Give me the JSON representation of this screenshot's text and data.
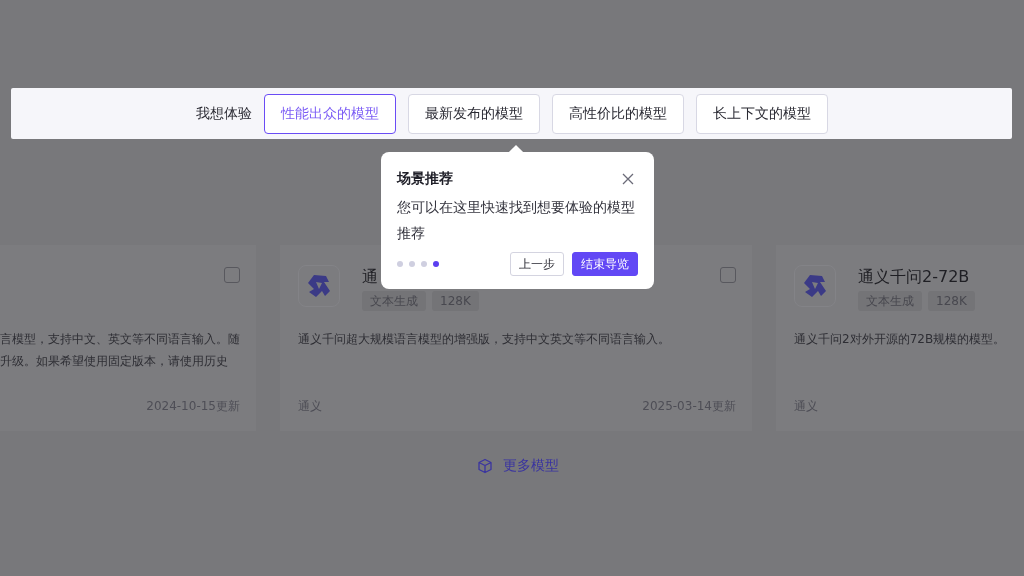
{
  "scenario_bar": {
    "label": "我想体验",
    "options": [
      {
        "label": "性能出众的模型",
        "selected": true
      },
      {
        "label": "最新发布的模型",
        "selected": false
      },
      {
        "label": "高性价比的模型",
        "selected": false
      },
      {
        "label": "长上下文的模型",
        "selected": false
      }
    ]
  },
  "model_cards": [
    {
      "checked": false,
      "description_lines": [
        "言模型，支持中文、英文等不同语言输入。随",
        "升级。如果希望使用固定版本，请使用历史"
      ],
      "date": "2024-10-15更新"
    },
    {
      "checked": false,
      "title": "通",
      "tags": [
        "文本生成",
        "128K"
      ],
      "description_lines": [
        "通义千问超大规模语言模型的增强版，支持中文英文等不同语言输入。"
      ],
      "provider": "通义",
      "date": "2025-03-14更新"
    },
    {
      "title": "通义千问2-72B",
      "tags": [
        "文本生成",
        "128K"
      ],
      "description_lines": [
        "通义千问2对外开源的72B规模的模型。"
      ],
      "provider": "通义"
    }
  ],
  "more_link": "更多模型",
  "tour_popover": {
    "title": "场景推荐",
    "body": "您可以在这里快速找到想要体验的模型推荐",
    "steps": [
      {
        "selected": false
      },
      {
        "selected": false
      },
      {
        "selected": false
      },
      {
        "selected": true
      }
    ],
    "buttons": [
      {
        "label": "上一步",
        "kind": "secondary"
      },
      {
        "label": "结束导览",
        "kind": "primary"
      }
    ]
  }
}
